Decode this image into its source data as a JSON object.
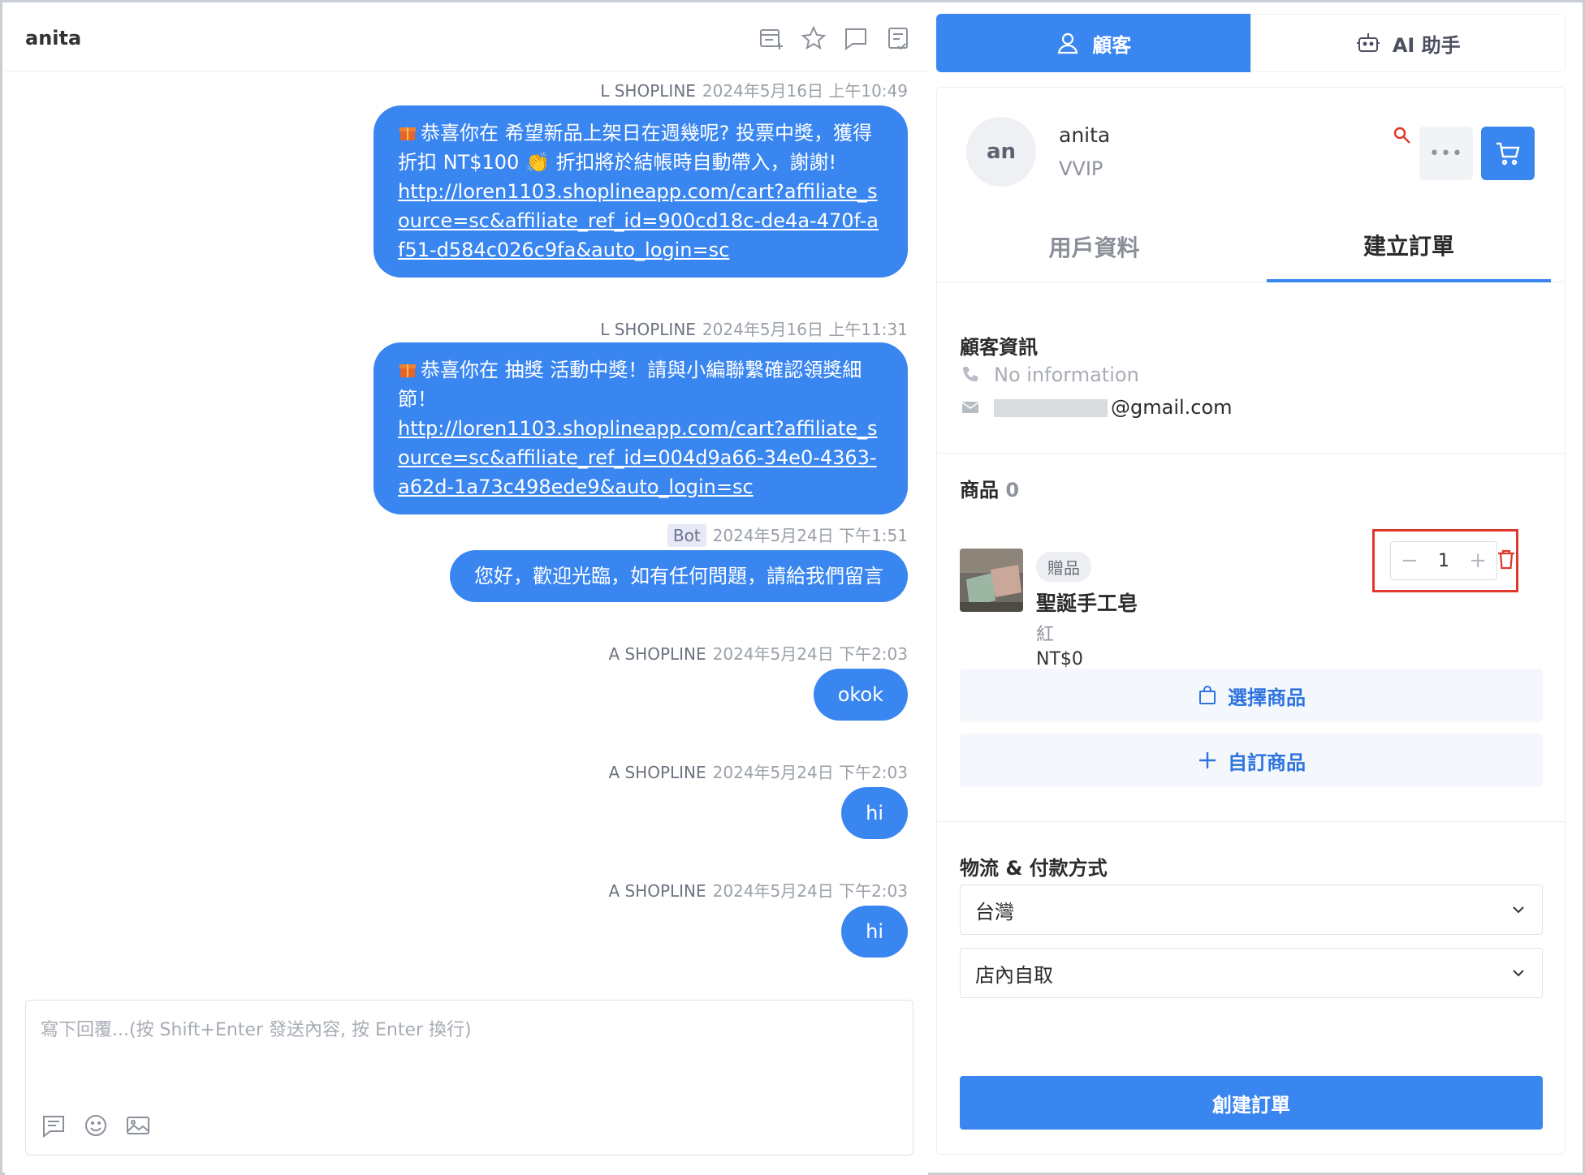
{
  "chat": {
    "title": "anita",
    "header_icons": [
      "add-note-icon",
      "star-icon",
      "comment-icon",
      "notes-icon"
    ],
    "messages": [
      {
        "sender": "L SHOPLINE",
        "time": "2024年5月16日 上午10:49",
        "text": "恭喜你在 希望新品上架日在週幾呢? 投票中獎，獲得折扣 NT$100 👏 折扣將於結帳時自動帶入，謝謝!",
        "link": "http://loren1103.shoplineapp.com/cart?affiliate_source=sc&affiliate_ref_id=900cd18c-de4a-470f-af51-d584c026c9fa&auto_login=sc"
      },
      {
        "sender": "L SHOPLINE",
        "time": "2024年5月16日 上午11:31",
        "text": "恭喜你在 抽獎 活動中獎！請與小編聯繫確認領獎細節！",
        "link": "http://loren1103.shoplineapp.com/cart?affiliate_source=sc&affiliate_ref_id=004d9a66-34e0-4363-a62d-1a73c498ede9&auto_login=sc"
      },
      {
        "sender": "Bot",
        "time": "2024年5月24日 下午1:51",
        "text": "您好，歡迎光臨，如有任何問題，請給我們留言"
      },
      {
        "sender": "A SHOPLINE",
        "time": "2024年5月24日 下午2:03",
        "text": "okok"
      },
      {
        "sender": "A SHOPLINE",
        "time": "2024年5月24日 下午2:03",
        "text": "hi"
      },
      {
        "sender": "A SHOPLINE",
        "time": "2024年5月24日 下午2:03",
        "text": "hi"
      }
    ],
    "composer": {
      "placeholder": "寫下回覆...(按 Shift+Enter 發送內容, 按 Enter 換行)",
      "tools": [
        "quick-reply-icon",
        "emoji-icon",
        "image-icon"
      ]
    }
  },
  "panel": {
    "tabs": [
      {
        "label": "顧客",
        "active": true
      },
      {
        "label": "AI 助手",
        "active": false
      }
    ],
    "customer": {
      "avatar_text": "an",
      "name": "anita",
      "level": "VVIP"
    },
    "subtabs": [
      {
        "label": "用戶資料",
        "active": false
      },
      {
        "label": "建立訂單",
        "active": true
      }
    ],
    "customer_info": {
      "title": "顧客資訊",
      "phone": "No information",
      "email_suffix": "@gmail.com"
    },
    "products": {
      "title": "商品",
      "count": "0",
      "items": [
        {
          "badge": "贈品",
          "name": "聖誕手工皂",
          "variant": "紅",
          "price": "NT$0",
          "quantity": "1"
        }
      ],
      "choose_label": "選擇商品",
      "custom_label": "自訂商品"
    },
    "logistics": {
      "title": "物流 & 付款方式",
      "country": "台灣",
      "delivery": "店內自取"
    },
    "create_label": "創建訂單"
  },
  "colors": {
    "primary": "#3a86f0",
    "highlight": "#e0372b",
    "danger": "#e0372b"
  }
}
